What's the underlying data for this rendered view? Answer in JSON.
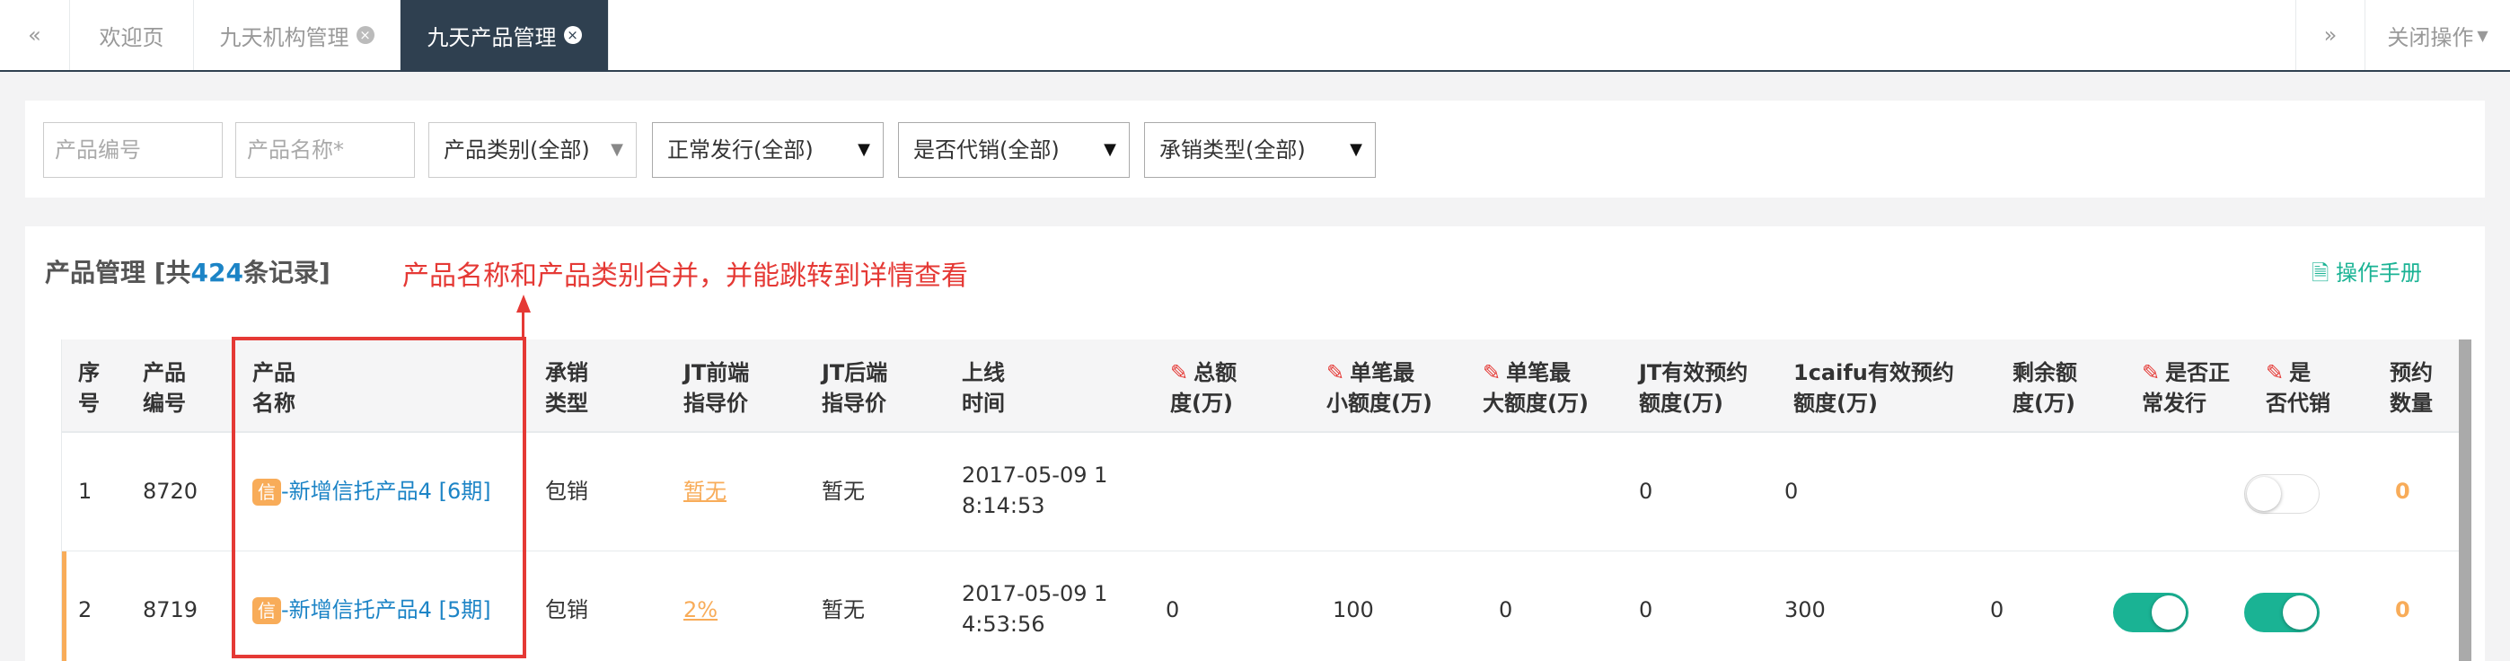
{
  "tabs": {
    "prev": "«",
    "items": [
      {
        "label": "欢迎页"
      },
      {
        "label": "九天机构管理"
      },
      {
        "label": "九天产品管理"
      }
    ],
    "next": "»",
    "close_ops": "关闭操作"
  },
  "filters": {
    "product_no_placeholder": "产品编号",
    "product_name_placeholder": "产品名称*",
    "category": "产品类别(全部)",
    "issue": "正常发行(全部)",
    "agency": "是否代销(全部)",
    "underwrite_type": "承销类型(全部)"
  },
  "panel": {
    "title_prefix": "产品管理 [共",
    "count": "424",
    "title_suffix": "条记录]",
    "annotation": "产品名称和产品类别合并，并能跳转到详情查看",
    "manual": "操作手册"
  },
  "table": {
    "headers": {
      "seq": [
        "序",
        "号"
      ],
      "code": [
        "产品",
        "编号"
      ],
      "name": [
        "产品",
        "名称"
      ],
      "type": [
        "承销",
        "类型"
      ],
      "jt_front": [
        "JT前端",
        "指导价"
      ],
      "jt_back": [
        "JT后端",
        "指导价"
      ],
      "online": [
        "上线",
        "时间"
      ],
      "total": [
        "总额",
        "度(万)"
      ],
      "min": [
        "单笔最",
        "小额度(万)"
      ],
      "max": [
        "单笔最",
        "大额度(万)"
      ],
      "jt_valid": [
        "JT有效预约",
        "额度(万)"
      ],
      "caifu_valid": [
        "1caifu有效预约",
        "额度(万)"
      ],
      "remain": [
        "剩余额",
        "度(万)"
      ],
      "normal": [
        "是否正",
        "常发行"
      ],
      "agent": [
        "是",
        "否代销"
      ],
      "reserve": [
        "预约",
        "数量"
      ]
    },
    "rows": [
      {
        "seq": "1",
        "code": "8720",
        "badge": "信",
        "name": "-新增信托产品4",
        "period": "[6期]",
        "type": "包销",
        "jt_front": "暂无",
        "jt_back": "暂无",
        "time1": "2017-05-09 1",
        "time2": "8:14:53",
        "total": "",
        "min": "",
        "max": "",
        "jt_valid": "0",
        "caifu_valid": "0",
        "remain": "",
        "normal_on": null,
        "agent_on": false,
        "reserve": "0"
      },
      {
        "seq": "2",
        "code": "8719",
        "badge": "信",
        "name": "-新增信托产品4",
        "period": "[5期]",
        "type": "包销",
        "jt_front": "2%",
        "jt_back": "暂无",
        "time1": "2017-05-09 1",
        "time2": "4:53:56",
        "total": "0",
        "min": "100",
        "max": "0",
        "jt_valid": "0",
        "caifu_valid": "300",
        "remain": "0",
        "normal_on": true,
        "agent_on": true,
        "reserve": "0"
      }
    ]
  },
  "colors": {
    "accent": "#1ab394",
    "link": "#1c84c6",
    "warn": "#f8ac59",
    "dark": "#2f4050",
    "annotation": "#e53935"
  }
}
